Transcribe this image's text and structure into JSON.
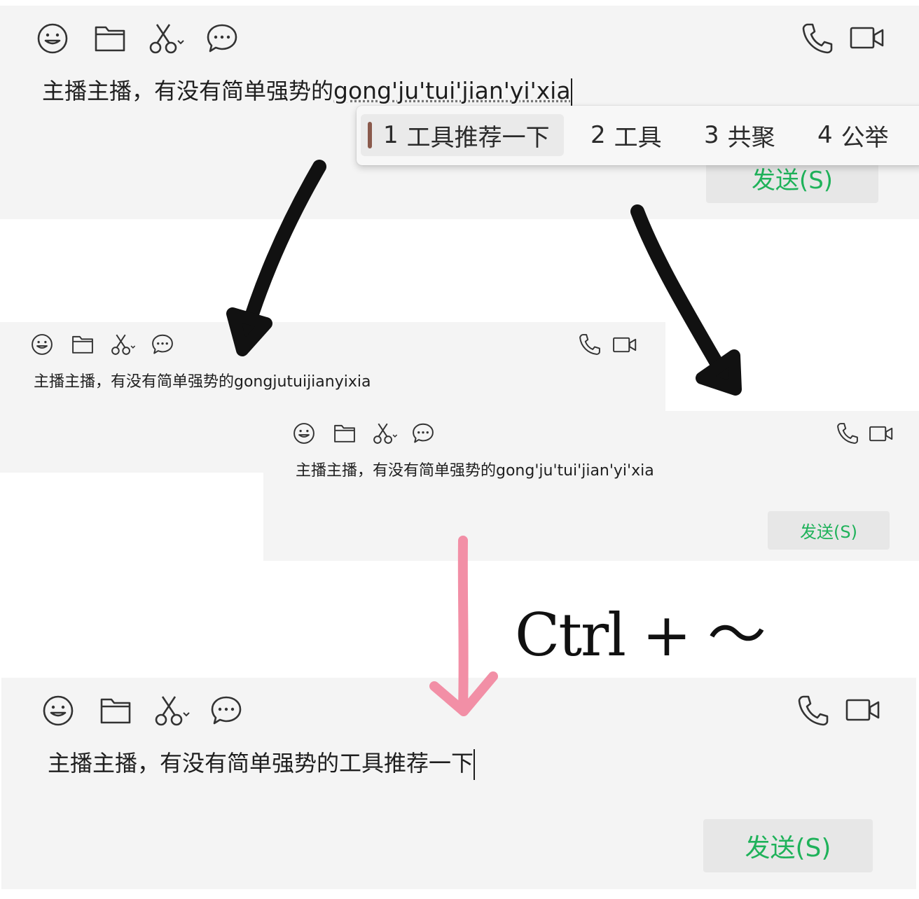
{
  "icons": {
    "emoji": "emoji-icon",
    "folder": "folder-icon",
    "scissors": "scissors-icon",
    "chat": "chat-bubble-icon",
    "phone": "phone-icon",
    "video": "video-icon"
  },
  "colors": {
    "panel_bg": "#f4f4f4",
    "send_text": "#1fb25a",
    "send_bg": "#e7e7e7",
    "black_arrow": "#111111",
    "pink_arrow": "#f28fa6",
    "candidate_marker": "#8a5a4c"
  },
  "panel_top": {
    "committed_text": "主播主播，有没有简单强势的",
    "composing_text": "gong'ju'tui'jian'yi'xia",
    "send_label": "发送(S)",
    "candidates": [
      {
        "num": "1",
        "text": "工具推荐一下",
        "selected": true
      },
      {
        "num": "2",
        "text": "工具",
        "selected": false
      },
      {
        "num": "3",
        "text": "共聚",
        "selected": false
      },
      {
        "num": "4",
        "text": "公举",
        "selected": false
      }
    ]
  },
  "panel_left": {
    "message_text": "主播主播，有没有简单强势的gongjutuijianyixia"
  },
  "panel_right": {
    "message_text": "主播主播，有没有简单强势的gong'ju'tui'jian'yi'xia",
    "send_label": "发送(S)"
  },
  "shortcut_label": "Ctrl + ～",
  "panel_bottom": {
    "message_text": "主播主播，有没有简单强势的工具推荐一下",
    "send_label": "发送(S)"
  }
}
